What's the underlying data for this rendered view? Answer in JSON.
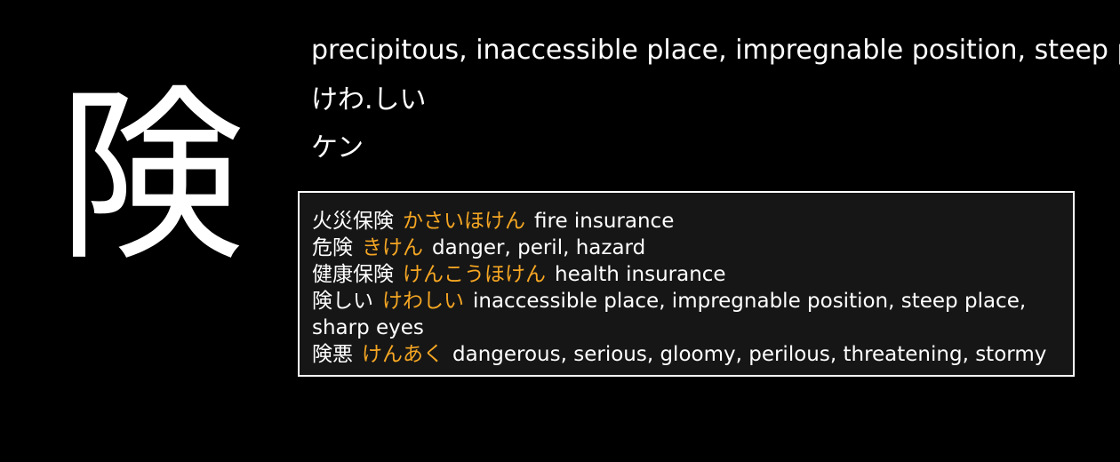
{
  "kanji": "険",
  "meaning": "precipitous, inaccessible place, impregnable position, steep place, sharp eyes",
  "kun_reading": "けわ.しい",
  "on_reading": "ケン",
  "colors": {
    "background": "#000000",
    "text": "#ffffff",
    "reading_accent": "#f5a623",
    "examples_background": "#161616"
  },
  "examples": [
    {
      "word": "火災保険",
      "reading": "かさいほけん",
      "gloss": "fire insurance"
    },
    {
      "word": "危険",
      "reading": "きけん",
      "gloss": "danger, peril, hazard"
    },
    {
      "word": "健康保険",
      "reading": "けんこうほけん",
      "gloss": "health insurance"
    },
    {
      "word": "険しい",
      "reading": "けわしい",
      "gloss": "inaccessible place, impregnable position, steep place, sharp eyes"
    },
    {
      "word": "険悪",
      "reading": "けんあく",
      "gloss": "dangerous, serious, gloomy, perilous, threatening, stormy"
    }
  ]
}
